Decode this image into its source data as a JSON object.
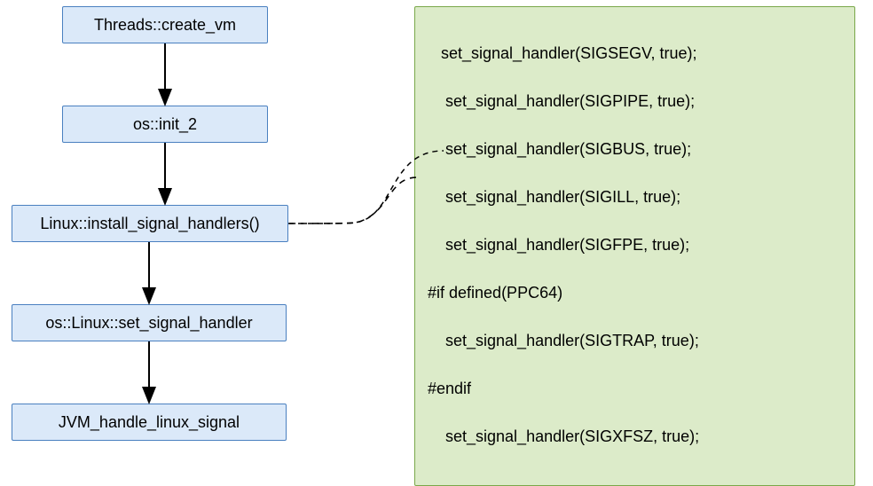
{
  "flow": {
    "box1": "Threads::create_vm",
    "box2": "os::init_2",
    "box3": "Linux::install_signal_handlers()",
    "box4": "os::Linux::set_signal_handler",
    "box5": "JVM_handle_linux_signal"
  },
  "code": {
    "line1": "   set_signal_handler(SIGSEGV, true);",
    "line2": "    set_signal_handler(SIGPIPE, true);",
    "line3": "    set_signal_handler(SIGBUS, true);",
    "line4": "    set_signal_handler(SIGILL, true);",
    "line5": "    set_signal_handler(SIGFPE, true);",
    "line6": "#if defined(PPC64)",
    "line7": "    set_signal_handler(SIGTRAP, true);",
    "line8": "#endif",
    "line9": "    set_signal_handler(SIGXFSZ, true);"
  },
  "colors": {
    "flow_fill": "#dbe9f9",
    "flow_border": "#4a80c0",
    "code_fill": "#dcebc9",
    "code_border": "#7aa84a"
  }
}
